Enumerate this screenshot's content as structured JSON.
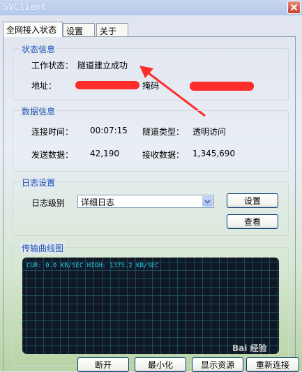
{
  "window": {
    "title": "SVClient"
  },
  "tabs": [
    {
      "label": "全网接入状态",
      "active": true
    },
    {
      "label": "设置",
      "active": false
    },
    {
      "label": "关于",
      "active": false
    }
  ],
  "status_group": {
    "legend": "状态信息",
    "work_status_label": "工作状态：",
    "work_status_value": "隧道建立成功",
    "address_label": "地址：",
    "mask_label": "掩码"
  },
  "data_group": {
    "legend": "数据信息",
    "connect_time_label": "连接时间：",
    "connect_time_value": "00:07:15",
    "tunnel_type_label": "隧道类型：",
    "tunnel_type_value": "透明访问",
    "sent_label": "发送数据：",
    "sent_value": "42,190",
    "received_label": "接收数据：",
    "received_value": "1,345,690"
  },
  "log_group": {
    "legend": "日志设置",
    "level_label": "日志级别",
    "level_value": "详细日志",
    "settings_button": "设置",
    "view_button": "查看"
  },
  "graph_group": {
    "legend": "传输曲线图",
    "stats_text": "CUR: 0.0 KB/SEC   HIGH: 1375.2 KB/SEC"
  },
  "bottom_buttons": {
    "disconnect": "断开",
    "minimize": "最小化",
    "show_resources": "显示资源",
    "reconnect": "重新连接"
  },
  "watermark": {
    "text": "Bai 经验"
  },
  "colors": {
    "legend_blue": "#1b4fb0",
    "graph_bg": "#101826",
    "graph_text": "#21d0ea",
    "annotation_red": "#ff2c2c"
  }
}
